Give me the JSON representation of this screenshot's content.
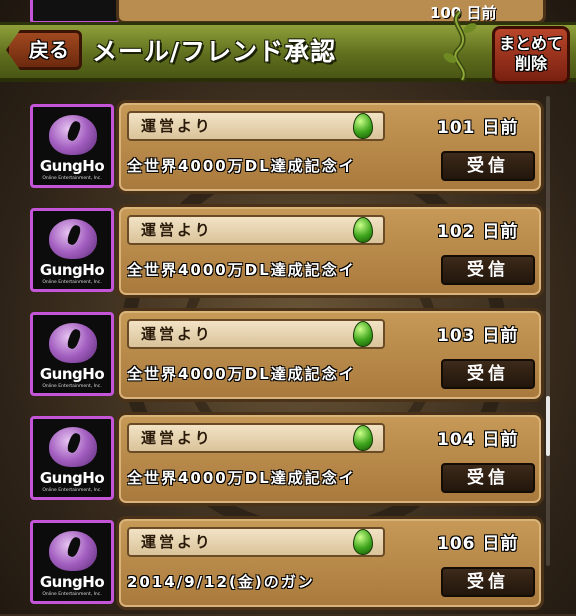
{
  "header": {
    "back_label": "戻る",
    "title": "メール/フレンド承認",
    "bulk_delete_line1": "まとめて",
    "bulk_delete_line2": "削除"
  },
  "top_partial": {
    "days_text": "100 日前"
  },
  "mails": [
    {
      "sender": "運営より",
      "days_text": "101 日前",
      "subject": "全世界4000万DL達成記念イ",
      "receive_label": "受信",
      "avatar_logo": "GungHo",
      "avatar_sub": "Online Entertainment, Inc."
    },
    {
      "sender": "運営より",
      "days_text": "102 日前",
      "subject": "全世界4000万DL達成記念イ",
      "receive_label": "受信",
      "avatar_logo": "GungHo",
      "avatar_sub": "Online Entertainment, Inc."
    },
    {
      "sender": "運営より",
      "days_text": "103 日前",
      "subject": "全世界4000万DL達成記念イ",
      "receive_label": "受信",
      "avatar_logo": "GungHo",
      "avatar_sub": "Online Entertainment, Inc."
    },
    {
      "sender": "運営より",
      "days_text": "104 日前",
      "subject": "全世界4000万DL達成記念イ",
      "receive_label": "受信",
      "avatar_logo": "GungHo",
      "avatar_sub": "Online Entertainment, Inc."
    },
    {
      "sender": "運営より",
      "days_text": "106 日前",
      "subject": "2014/9/12(金)のガン",
      "receive_label": "受信",
      "avatar_logo": "GungHo",
      "avatar_sub": "Online Entertainment, Inc."
    }
  ],
  "icons": {
    "attachment": "green-egg-icon",
    "back": "back-arrow-icon"
  },
  "colors": {
    "header_green": "#5f6f1e",
    "avatar_border": "#c455d8",
    "back_button": "#8a3515",
    "bulk_button": "#a23a20"
  }
}
